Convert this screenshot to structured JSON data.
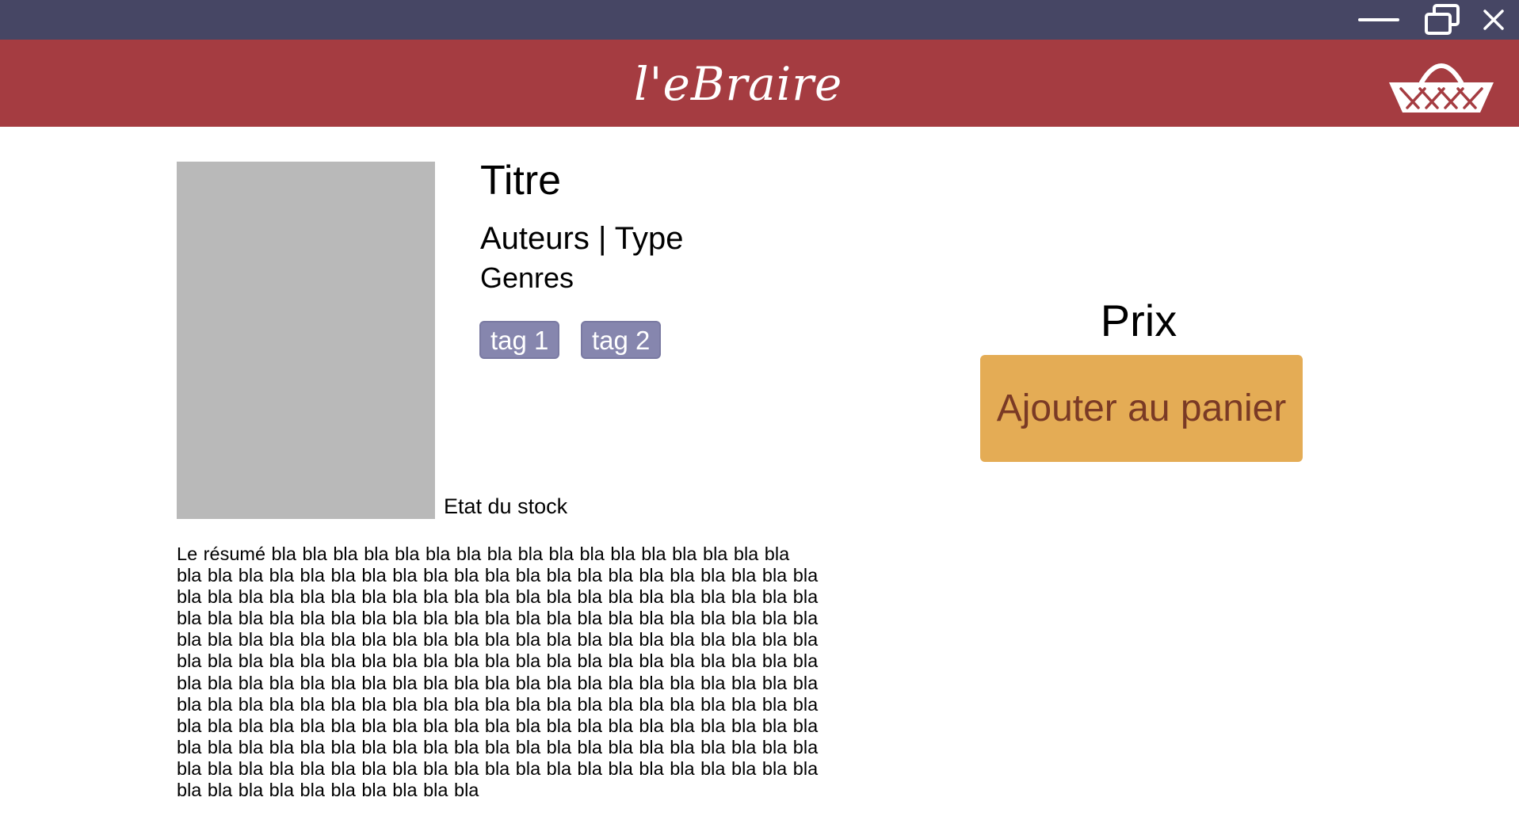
{
  "window_controls": {
    "minimize": "minimize-icon",
    "restore": "restore-icon",
    "close": "close-icon"
  },
  "header": {
    "logo_text": "l'eBraire",
    "cart_icon": "basket-icon",
    "colors": {
      "titlebar": "#464664",
      "header": "#a53c41"
    }
  },
  "product": {
    "title": "Titre",
    "authors_type": "Auteurs | Type",
    "genres": "Genres",
    "tags": [
      "tag 1",
      "tag 2"
    ],
    "stock": "Etat du stock",
    "price": "Prix",
    "add_to_cart_label": "Ajouter au panier",
    "summary": "Le résumé bla bla bla bla bla bla bla bla bla bla bla bla bla bla bla bla bla bla bla bla bla bla bla bla bla bla bla bla bla bla bla bla bla bla bla bla bla bla bla bla bla bla bla bla bla bla bla bla bla bla bla bla bla bla bla bla bla bla bla bla bla bla bla bla bla bla bla bla bla bla bla bla bla bla bla bla bla bla bla bla bla bla bla bla bla bla bla bla bla bla bla bla bla bla bla bla bla bla bla bla bla bla bla bla bla bla bla bla bla bla bla bla bla bla bla bla bla bla bla bla bla bla bla bla bla bla bla bla bla bla bla bla bla bla bla bla bla bla bla bla bla bla bla bla bla bla bla bla bla bla bla bla bla bla bla bla bla bla bla bla bla bla bla bla bla bla bla bla bla bla bla bla bla bla bla bla bla bla bla bla bla bla bla bla bla bla bla bla bla bla bla bla bla bla bla bla bla bla bla bla bla bla bla bla bla bla bla bla bla bla bla bla bla bla bla bla bla bla bla bla bla bla bla bla bla bla bla bla bla bla bla bla bla bla bla bla bla"
  }
}
